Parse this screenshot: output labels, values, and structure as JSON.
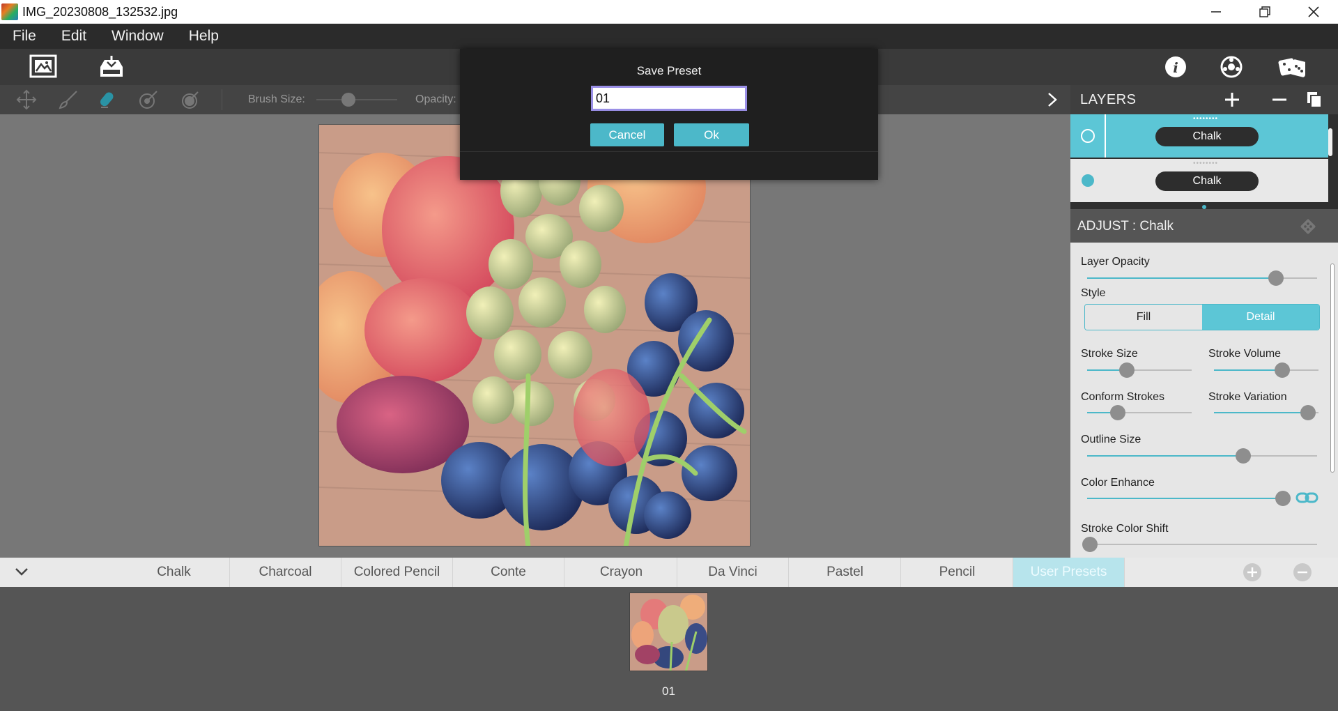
{
  "window": {
    "title": "IMG_20230808_132532.jpg"
  },
  "menu": {
    "items": [
      "File",
      "Edit",
      "Window",
      "Help"
    ]
  },
  "toolbar": {
    "left_icons": [
      "open-image-icon",
      "save-icon"
    ],
    "right_icons": [
      "info-icon",
      "settings-icon",
      "random-dice-icon"
    ]
  },
  "tool_options": {
    "tools": [
      "move-icon",
      "brush-icon",
      "eraser-icon",
      "restore-brush-icon",
      "fill-brush-icon"
    ],
    "brush_size_label": "Brush Size:",
    "brush_size_value": 0.4,
    "opacity_label": "Opacity:"
  },
  "layers": {
    "title": "LAYERS",
    "items": [
      {
        "name": "Chalk",
        "selected": true
      },
      {
        "name": "Chalk",
        "selected": false
      }
    ]
  },
  "adjust": {
    "title": "ADJUST : Chalk",
    "layer_opacity": {
      "label": "Layer Opacity",
      "value": 0.82
    },
    "style": {
      "label": "Style",
      "options": [
        "Fill",
        "Detail"
      ],
      "selected": "Detail"
    },
    "stroke_size": {
      "label": "Stroke Size",
      "value": 0.38
    },
    "stroke_volume": {
      "label": "Stroke Volume",
      "value": 0.65
    },
    "conform_strokes": {
      "label": "Conform Strokes",
      "value": 0.29
    },
    "stroke_variation": {
      "label": "Stroke Variation",
      "value": 0.9
    },
    "outline_size": {
      "label": "Outline Size",
      "value": 0.68
    },
    "color_enhance": {
      "label": "Color Enhance",
      "value": 0.97
    },
    "stroke_color_shift": {
      "label": "Stroke Color Shift",
      "value": 0.0
    }
  },
  "presets": {
    "tabs": [
      "Chalk",
      "Charcoal",
      "Colored Pencil",
      "Conte",
      "Crayon",
      "Da Vinci",
      "Pastel",
      "Pencil",
      "User Presets"
    ],
    "active_tab": "User Presets",
    "items": [
      {
        "label": "01"
      }
    ]
  },
  "dialog": {
    "title": "Save Preset",
    "input_value": "01",
    "cancel_label": "Cancel",
    "ok_label": "Ok"
  },
  "colors": {
    "accent": "#4cb8c9",
    "menubar": "#2b2b2b",
    "canvas_bg": "#777777"
  }
}
